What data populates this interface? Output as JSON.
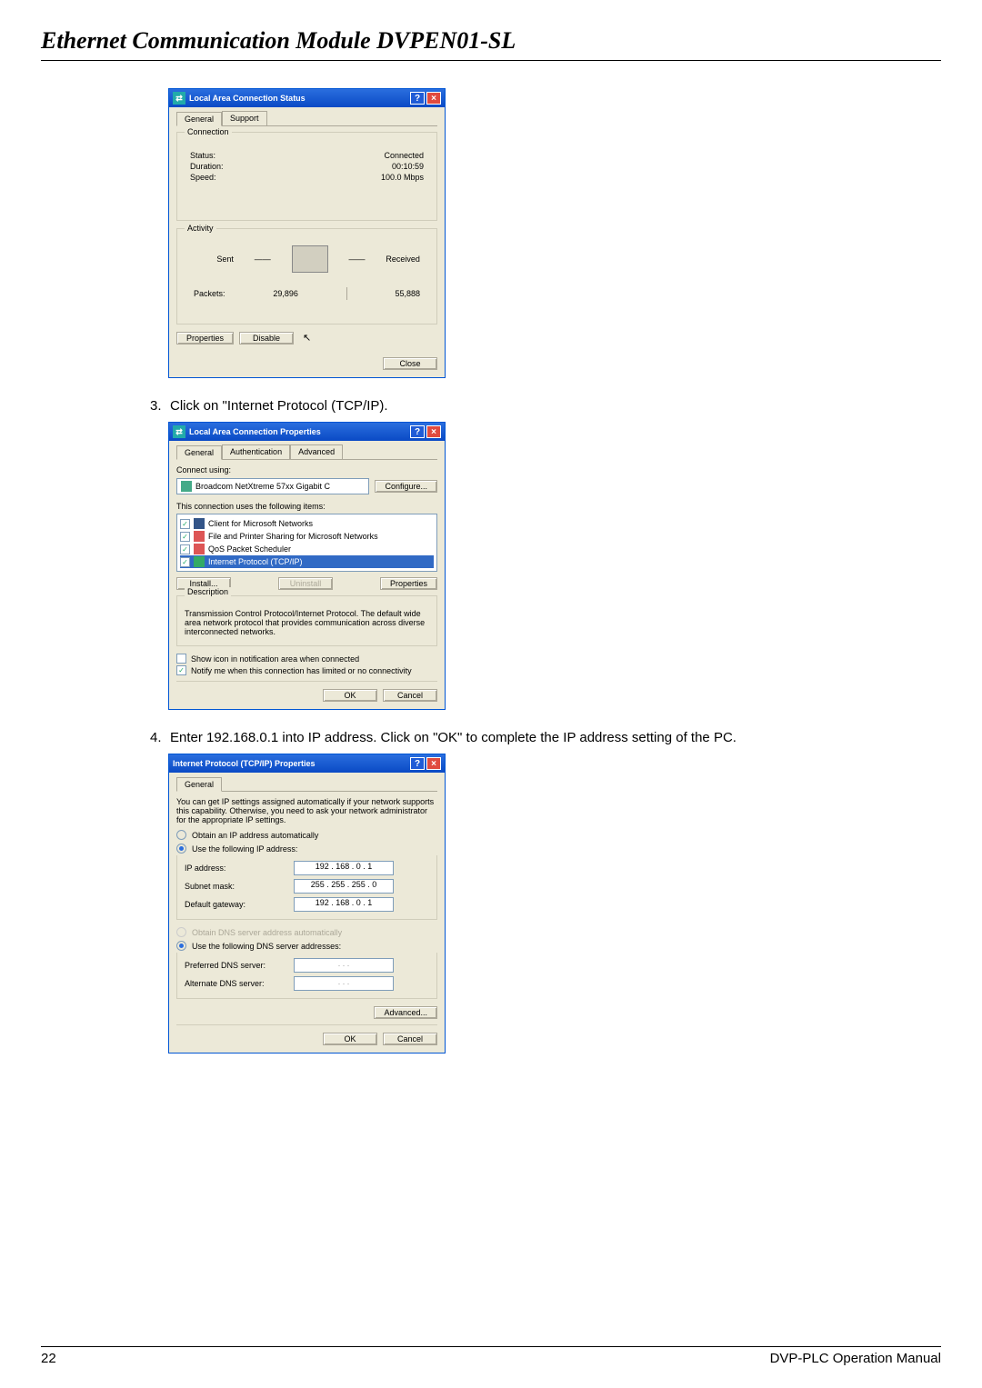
{
  "doc_title": "Ethernet Communication Module DVPEN01-SL",
  "page_number": "22",
  "footer_right": "DVP-PLC Operation Manual",
  "steps": [
    {
      "num": "3.",
      "text": "Click on \"Internet Protocol (TCP/IP)."
    },
    {
      "num": "4.",
      "text": "Enter 192.168.0.1 into IP address. Click on \"OK\" to complete the IP address setting of the PC."
    }
  ],
  "dlg_status": {
    "title": "Local Area Connection Status",
    "tabs": {
      "general": "General",
      "support": "Support"
    },
    "connection_label": "Connection",
    "rows": {
      "status_l": "Status:",
      "status_v": "Connected",
      "duration_l": "Duration:",
      "duration_v": "00:10:59",
      "speed_l": "Speed:",
      "speed_v": "100.0 Mbps"
    },
    "activity_label": "Activity",
    "sent": "Sent",
    "received": "Received",
    "packets_l": "Packets:",
    "packets_s": "29,896",
    "packets_r": "55,888",
    "properties": "Properties",
    "disable": "Disable",
    "close": "Close"
  },
  "dlg_props": {
    "title": "Local Area Connection Properties",
    "tabs": {
      "general": "General",
      "auth": "Authentication",
      "adv": "Advanced"
    },
    "connect_using": "Connect using:",
    "adapter": "Broadcom NetXtreme 57xx Gigabit C",
    "configure": "Configure...",
    "uses_label": "This connection uses the following items:",
    "items": [
      "Client for Microsoft Networks",
      "File and Printer Sharing for Microsoft Networks",
      "QoS Packet Scheduler",
      "Internet Protocol (TCP/IP)"
    ],
    "install": "Install...",
    "uninstall": "Uninstall",
    "properties": "Properties",
    "desc_label": "Description",
    "desc_text": "Transmission Control Protocol/Internet Protocol. The default wide area network protocol that provides communication across diverse interconnected networks.",
    "show_icon": "Show icon in notification area when connected",
    "notify": "Notify me when this connection has limited or no connectivity",
    "ok": "OK",
    "cancel": "Cancel"
  },
  "dlg_tcpip": {
    "title": "Internet Protocol (TCP/IP) Properties",
    "tabs": {
      "general": "General"
    },
    "note": "You can get IP settings assigned automatically if your network supports this capability. Otherwise, you need to ask your network administrator for the appropriate IP settings.",
    "obtain_ip": "Obtain an IP address automatically",
    "use_ip": "Use the following IP address:",
    "ip_l": "IP address:",
    "ip_v": "192 . 168 .   0  .   1",
    "mask_l": "Subnet mask:",
    "mask_v": "255 . 255 . 255 .   0",
    "gw_l": "Default gateway:",
    "gw_v": "192 . 168 .   0  .   1",
    "obtain_dns": "Obtain DNS server address automatically",
    "use_dns": "Use the following DNS server addresses:",
    "pdns_l": "Preferred DNS server:",
    "pdns_v": " .       .       .",
    "adns_l": "Alternate DNS server:",
    "adns_v": " .       .       .",
    "advanced": "Advanced...",
    "ok": "OK",
    "cancel": "Cancel"
  }
}
